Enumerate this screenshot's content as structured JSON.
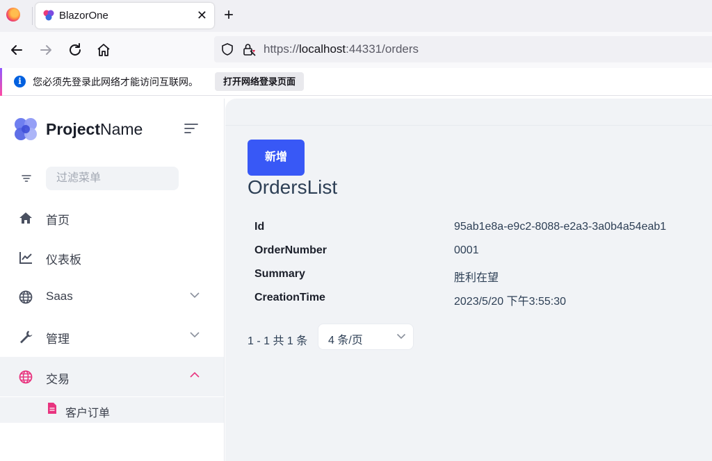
{
  "browser": {
    "tab_title": "BlazorOne",
    "url_scheme": "https://",
    "url_host": "localhost",
    "url_rest": ":44331/orders",
    "notification_text": "您必须先登录此网络才能访问互联网。",
    "notification_button": "打开网络登录页面"
  },
  "sidebar": {
    "brand_bold": "Project",
    "brand_light": "Name",
    "filter_placeholder": "过滤菜单",
    "items": [
      {
        "label": "首页",
        "icon": "home-icon"
      },
      {
        "label": "仪表板",
        "icon": "chart-line-icon"
      },
      {
        "label": "Saas",
        "icon": "globe-icon",
        "expandable": true
      },
      {
        "label": "管理",
        "icon": "wrench-icon",
        "expandable": true
      },
      {
        "label": "交易",
        "icon": "globe-icon",
        "expandable": true,
        "expanded": true
      }
    ],
    "subitems": [
      {
        "label": "客户订单",
        "icon": "file-icon"
      }
    ],
    "accent_color": "#e8347f"
  },
  "main": {
    "add_button": "新增",
    "title": "OrdersList",
    "fields": [
      {
        "key": "Id",
        "value": "95ab1e8a-e9c2-8088-e2a3-3a0b4a54eab1"
      },
      {
        "key": "OrderNumber",
        "value": "0001"
      },
      {
        "key": "Summary",
        "value": "胜利在望"
      },
      {
        "key": "CreationTime",
        "value": "2023/5/20 下午3:55:30"
      }
    ],
    "pager_info": "1 - 1 共 1 条",
    "page_size": "4 条/页",
    "primary_color": "#3858f6"
  }
}
